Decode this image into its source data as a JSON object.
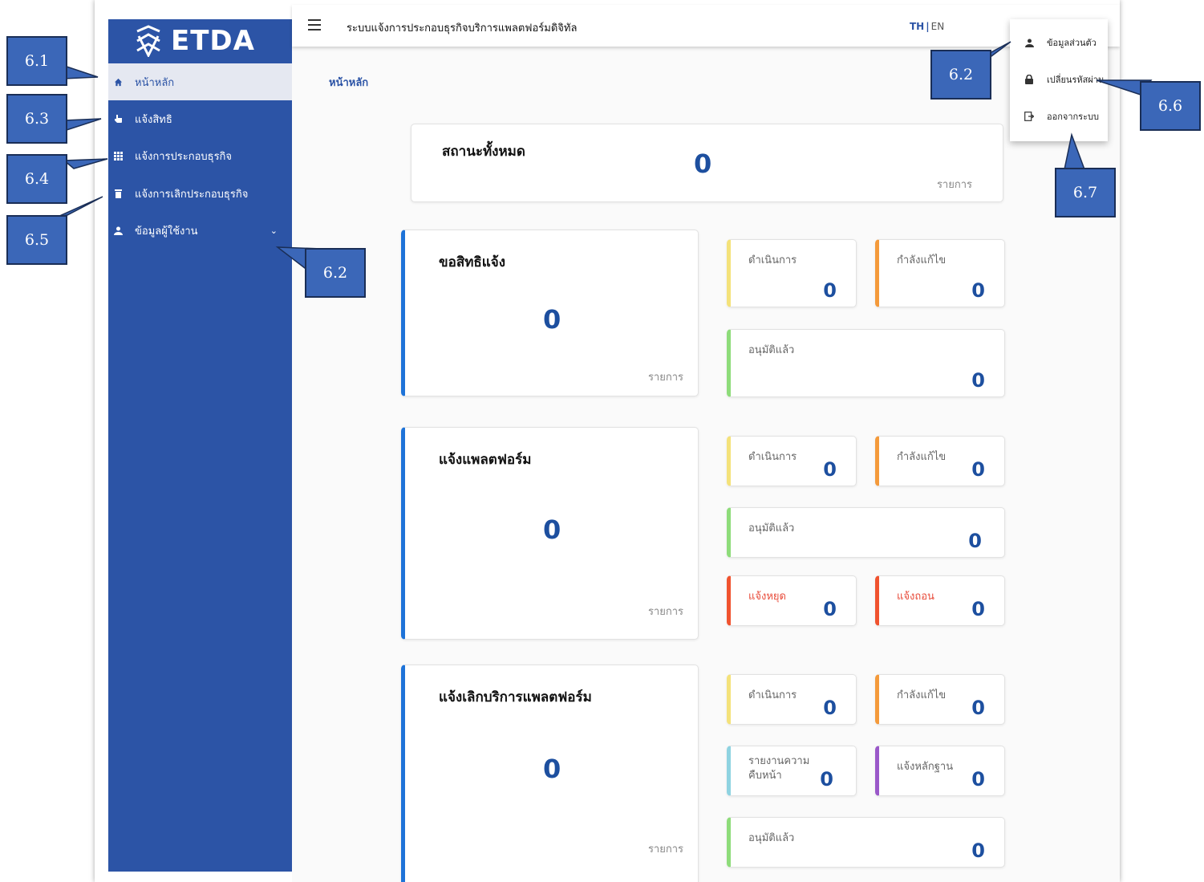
{
  "sidebar": {
    "logo_text": "ETDA",
    "items": [
      {
        "label": "หน้าหลัก",
        "icon": "home-icon",
        "active": true
      },
      {
        "label": "แจ้งสิทธิ",
        "icon": "hand-point-icon",
        "active": false
      },
      {
        "label": "แจ้งการประกอบธุรกิจ",
        "icon": "grid-icon",
        "active": false
      },
      {
        "label": "แจ้งการเลิกประกอบธุรกิจ",
        "icon": "trash-icon",
        "active": false
      },
      {
        "label": "ข้อมูลผู้ใช้งาน",
        "icon": "user-icon",
        "active": false,
        "expandable": true
      }
    ]
  },
  "header": {
    "title": "ระบบแจ้งการประกอบธุรกิจบริการแพลตฟอร์มดิจิทัล",
    "lang_th": "TH",
    "lang_sep": "|",
    "lang_en": "EN"
  },
  "user_menu": {
    "items": [
      {
        "label": "ข้อมูลส่วนตัว",
        "icon": "user-icon"
      },
      {
        "label": "เปลี่ยนรหัสผ่าน",
        "icon": "lock-icon"
      },
      {
        "label": "ออกจากระบบ",
        "icon": "logout-icon"
      }
    ]
  },
  "breadcrumb": "หน้าหลัก",
  "summary": {
    "title": "สถานะทั้งหมด",
    "value": "0",
    "unit": "รายการ"
  },
  "groups": [
    {
      "title": "ขอสิทธิแจ้ง",
      "value": "0",
      "unit": "รายการ",
      "stats": [
        {
          "label": "ดำเนินการ",
          "value": "0"
        },
        {
          "label": "กำลังแก้ไข",
          "value": "0"
        },
        {
          "label": "อนุมัติแล้ว",
          "value": "0"
        }
      ]
    },
    {
      "title": "แจ้งแพลตฟอร์ม",
      "value": "0",
      "unit": "รายการ",
      "stats": [
        {
          "label": "ดำเนินการ",
          "value": "0"
        },
        {
          "label": "กำลังแก้ไข",
          "value": "0"
        },
        {
          "label": "อนุมัติแล้ว",
          "value": "0"
        },
        {
          "label": "แจ้งหยุด",
          "value": "0"
        },
        {
          "label": "แจ้งถอน",
          "value": "0"
        }
      ]
    },
    {
      "title": "แจ้งเลิกบริการแพลตฟอร์ม",
      "value": "0",
      "unit": "รายการ",
      "stats": [
        {
          "label": "ดำเนินการ",
          "value": "0"
        },
        {
          "label": "กำลังแก้ไข",
          "value": "0"
        },
        {
          "label": "รายงานความคืบหน้า",
          "value": "0"
        },
        {
          "label": "แจ้งหลักฐาน",
          "value": "0"
        },
        {
          "label": "อนุมัติแล้ว",
          "value": "0"
        }
      ]
    }
  ],
  "callouts": [
    "6.1",
    "6.3",
    "6.4",
    "6.5",
    "6.2",
    "6.2",
    "6.6",
    "6.7"
  ],
  "colors": {
    "sidebar": "#2c54a6",
    "accent": "#1d4f9f",
    "yellow": "#f4e27a",
    "orange": "#f49a3b",
    "green": "#8edc7a",
    "red": "#f0532f",
    "cyan": "#8fd3e1",
    "purple": "#9a58c9",
    "callout": "#3b67b8"
  }
}
